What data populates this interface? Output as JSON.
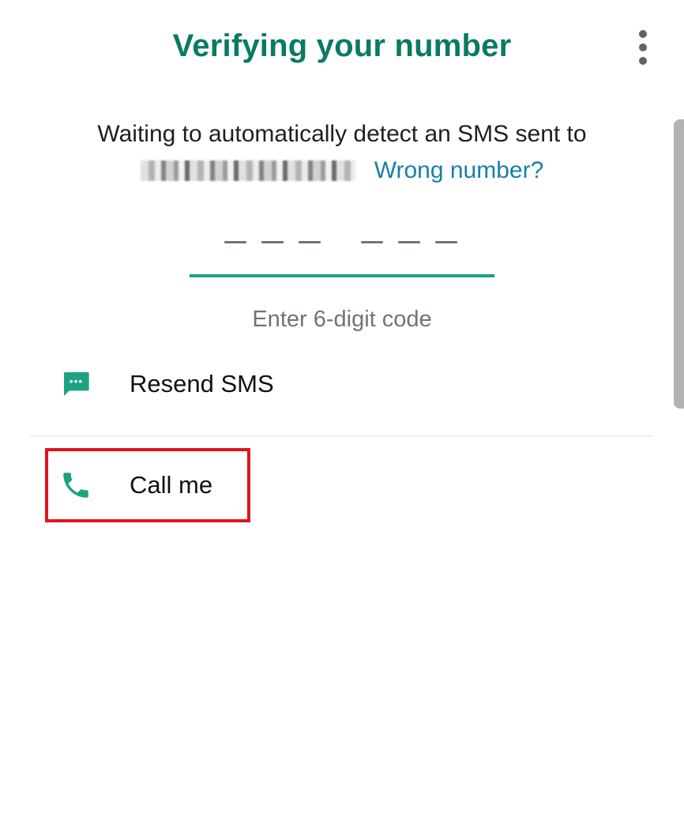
{
  "header": {
    "title": "Verifying your number",
    "menu_icon": "more-vert-icon"
  },
  "description": {
    "line1": "Waiting to automatically detect an SMS sent to",
    "phone_number_masked": "",
    "wrong_number_link": "Wrong number?"
  },
  "code_input": {
    "digits": 6,
    "value": "",
    "hint": "Enter 6-digit code"
  },
  "options": [
    {
      "label": "Resend SMS",
      "icon": "message-icon"
    },
    {
      "label": "Call me",
      "icon": "phone-icon"
    }
  ],
  "colors": {
    "accent": "#0b7a62",
    "underline": "#1da382",
    "link": "#1a7fa6",
    "highlight": "#e0141e"
  }
}
